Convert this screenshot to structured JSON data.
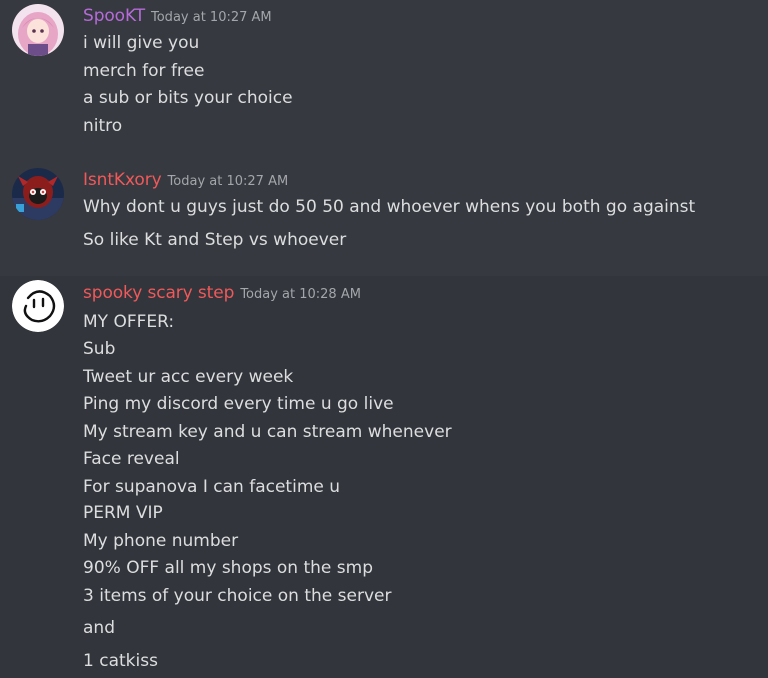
{
  "messages": [
    {
      "username": "SpooKT",
      "username_color": "#b66bd9",
      "timestamp": "Today at 10:27 AM",
      "lines": [
        "i will give you",
        "merch for free",
        "a sub or bits your choice",
        "nitro"
      ]
    },
    {
      "username": "IsntKxory",
      "username_color": "#f0595a",
      "timestamp": "Today at 10:27 AM",
      "lines": [
        "Why dont u guys just do 50 50 and whoever whens you both go against",
        "So like Kt and Step vs whoever"
      ]
    },
    {
      "username": "spooky scary step",
      "username_color": "#f0595a",
      "timestamp": "Today at 10:28 AM",
      "lines": [
        "MY OFFER:",
        "Sub",
        "Tweet ur acc every week",
        "Ping my discord every time u go live",
        "My stream key and u can stream whenever",
        "Face reveal",
        "For supanova I can facetime u",
        "PERM VIP",
        "My phone number",
        "90% OFF all my shops on the smp",
        "3 items of your choice on the server",
        "and",
        "1 catkiss"
      ]
    }
  ]
}
